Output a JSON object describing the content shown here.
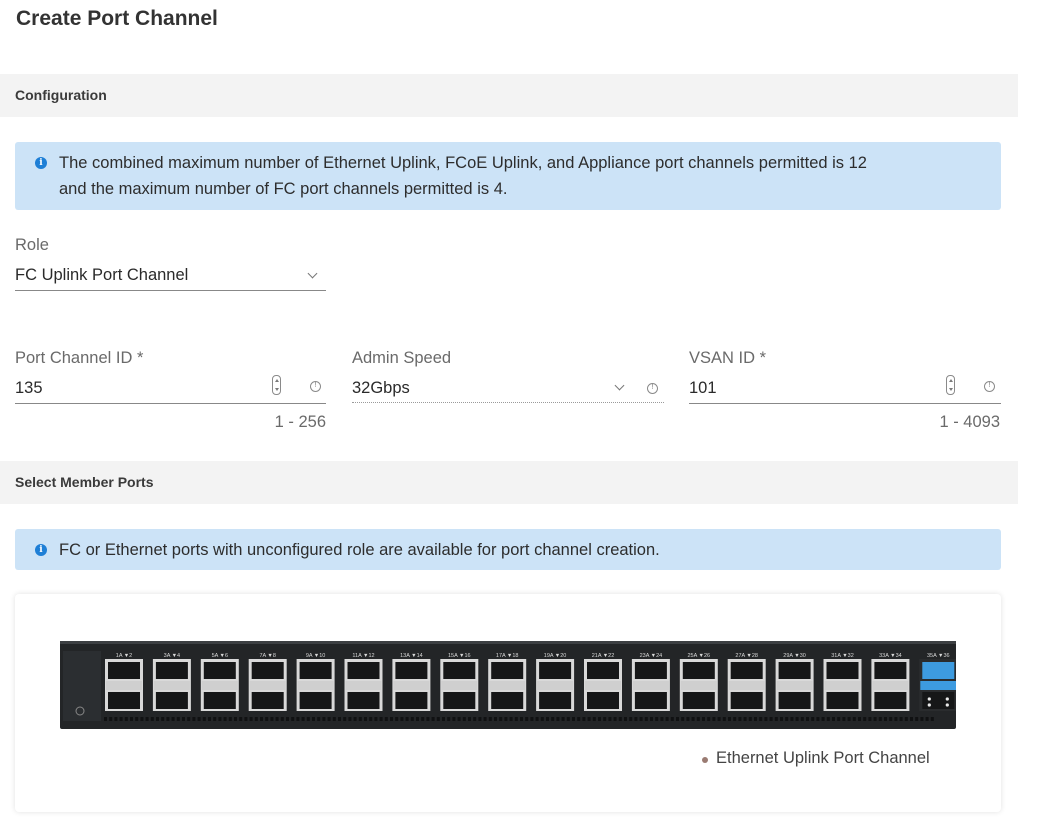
{
  "page": {
    "title": "Create Port Channel"
  },
  "configuration": {
    "section_title": "Configuration",
    "info_line1": "The combined maximum number of Ethernet Uplink, FCoE Uplink, and Appliance port channels permitted is 12",
    "info_line2": "and the maximum number of FC port channels permitted is 4.",
    "info_icon": "info-icon"
  },
  "role": {
    "label": "Role",
    "value": "FC Uplink Port Channel"
  },
  "port_channel_id": {
    "label": "Port Channel ID *",
    "value": "135",
    "hint": "1 - 256"
  },
  "admin_speed": {
    "label": "Admin Speed",
    "value": "32Gbps"
  },
  "vsan_id": {
    "label": "VSAN ID *",
    "value": "101",
    "hint": "1 - 4093"
  },
  "member_ports": {
    "section_title": "Select Member Ports",
    "info": "FC or Ethernet ports with unconfigured role are available for port channel creation.",
    "switch": {
      "port_pair_labels": [
        "1A ▼2",
        "3A ▼4",
        "5A ▼6",
        "7A ▼8",
        "9A ▼10",
        "11A ▼12",
        "13A ▼14",
        "15A ▼16",
        "17A ▼18",
        "19A ▼20",
        "21A ▼22",
        "23A ▼24",
        "25A ▼26",
        "27A ▼28",
        "29A ▼30",
        "31A ▼32",
        "33A ▼34",
        "35A ▼36"
      ],
      "highlighted_pair_index": 17,
      "highlight_color": "#3d9be0"
    },
    "legend": [
      {
        "label": "Ethernet Uplink Port Channel",
        "color": "#9a7b72"
      }
    ]
  }
}
